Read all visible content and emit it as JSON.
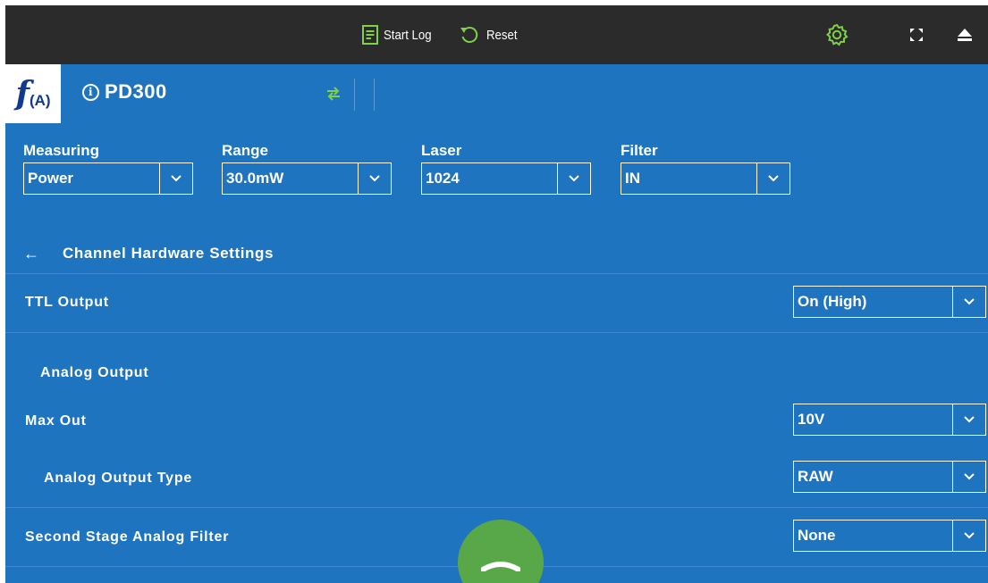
{
  "toolbar": {
    "start_log_label": "Start Log",
    "reset_label": "Reset",
    "icons": [
      "log-icon",
      "reset-icon",
      "settings-gear-icon",
      "fullscreen-icon",
      "eject-icon"
    ]
  },
  "header": {
    "logo_f": "f",
    "logo_a": "(A)",
    "device_name": "PD300"
  },
  "selectors": {
    "measuring": {
      "title": "Measuring",
      "value": "Power"
    },
    "range": {
      "title": "Range",
      "value": "30.0mW"
    },
    "laser": {
      "title": "Laser",
      "value": "1024"
    },
    "filter": {
      "title": "Filter",
      "value": "IN"
    }
  },
  "settings": {
    "back_arrow": "←",
    "title": "Channel Hardware Settings",
    "ttl_output": {
      "label": "TTL Output",
      "value": "On (High)"
    },
    "analog_output_heading": "Analog Output",
    "max_out": {
      "label": "Max Out",
      "value": "10V"
    },
    "analog_output_type": {
      "label": "Analog Output Type",
      "value": "RAW"
    },
    "second_stage_filter": {
      "label": "Second Stage Analog Filter",
      "value": "None"
    }
  },
  "colors": {
    "background": "#1f74bf",
    "toolbar": "#2b2b2b",
    "accent_green": "#7fd14a",
    "fab_green": "#58a84a",
    "logo_blue": "#123a8c"
  }
}
